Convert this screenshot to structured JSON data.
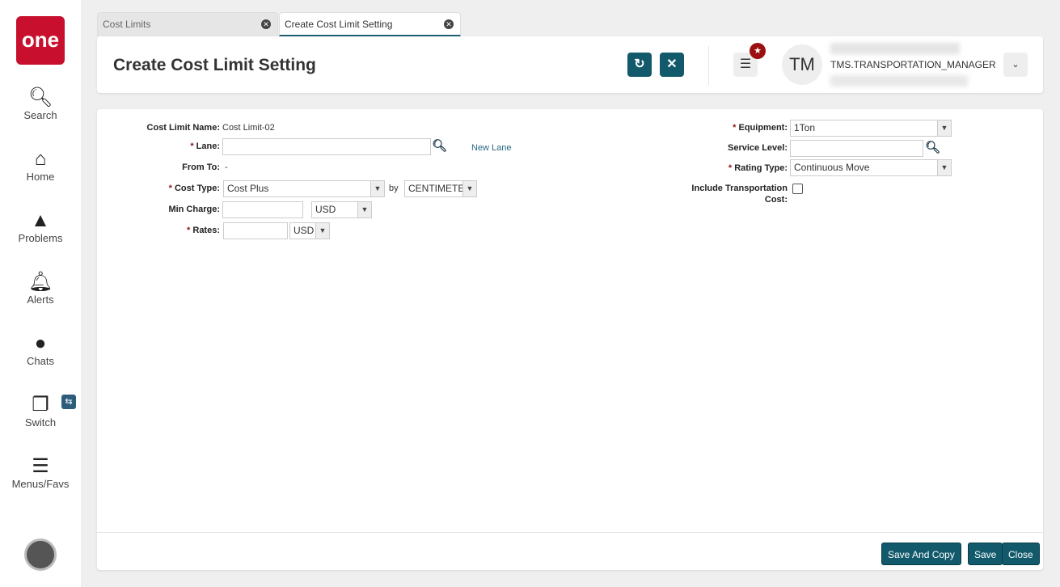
{
  "sidebar": {
    "logo": "one",
    "items": [
      {
        "label": "Search"
      },
      {
        "label": "Home"
      },
      {
        "label": "Problems"
      },
      {
        "label": "Alerts"
      },
      {
        "label": "Chats"
      },
      {
        "label": "Switch"
      },
      {
        "label": "Menus/Favs"
      }
    ]
  },
  "tabs": [
    {
      "label": "Cost Limits"
    },
    {
      "label": "Create Cost Limit Setting"
    }
  ],
  "header": {
    "title": "Create Cost Limit Setting",
    "avatar": "TM",
    "user": "TMS.TRANSPORTATION_MANAGER"
  },
  "form": {
    "cost_limit_name_label": "Cost Limit Name:",
    "cost_limit_name": "Cost Limit-02",
    "lane_label": "Lane:",
    "lane_value": "",
    "new_lane": "New Lane",
    "from_to_label": "From To:",
    "from_to": "-",
    "cost_type_label": "Cost Type:",
    "cost_type": "Cost Plus",
    "by": "by",
    "uom": "CENTIMETE",
    "min_charge_label": "Min Charge:",
    "min_charge": "",
    "min_charge_currency": "USD",
    "rates_label": "Rates:",
    "rates": "",
    "rates_currency": "USD",
    "equipment_label": "Equipment:",
    "equipment": "1Ton",
    "service_level_label": "Service Level:",
    "service_level": "",
    "rating_type_label": "Rating Type:",
    "rating_type": "Continuous Move",
    "include_transport_label": "Include Transportation Cost:",
    "include_transport": false,
    "required_mark": "*"
  },
  "footer": {
    "save_and_copy": "Save And Copy",
    "save": "Save",
    "close": "Close"
  }
}
